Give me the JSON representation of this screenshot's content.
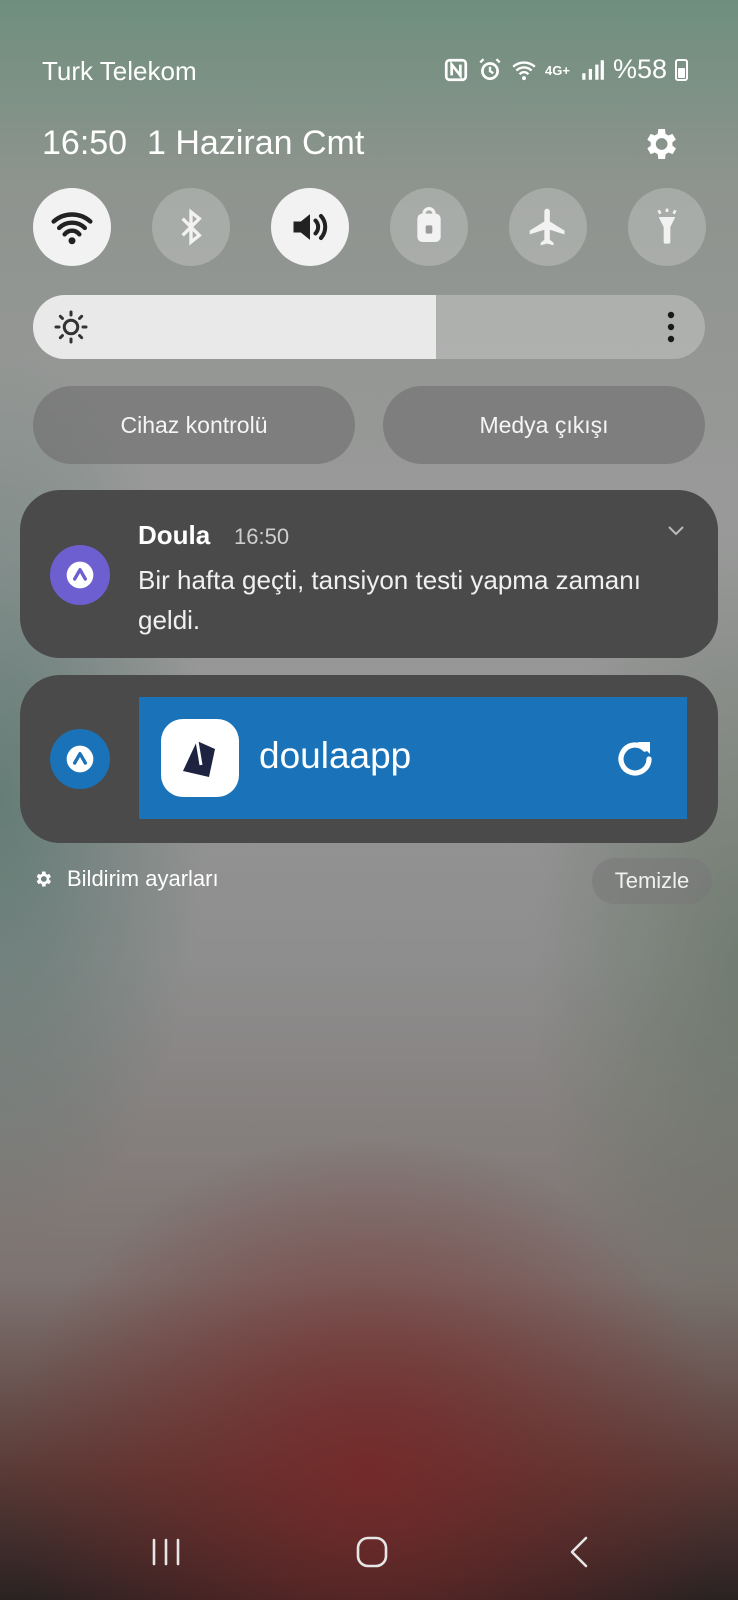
{
  "status_bar": {
    "carrier": "Turk Telekom",
    "battery_text": "%58",
    "icons": [
      "nfc-icon",
      "alarm-icon",
      "wifi-icon",
      "lte-plus-icon",
      "signal-icon",
      "battery-icon"
    ]
  },
  "panel": {
    "time": "16:50",
    "date": "1 Haziran Cmt",
    "quick_toggles": [
      {
        "name": "wifi",
        "on": true
      },
      {
        "name": "bluetooth",
        "on": false
      },
      {
        "name": "sound",
        "on": true
      },
      {
        "name": "screen-lock",
        "on": false
      },
      {
        "name": "airplane-mode",
        "on": false
      },
      {
        "name": "flashlight",
        "on": false
      }
    ],
    "brightness_level": 0.6,
    "device_control_label": "Cihaz kontrolü",
    "media_output_label": "Medya çıkışı"
  },
  "notifications": [
    {
      "app": "Doula",
      "time": "16:50",
      "body": "Bir hafta geçti, tansiyon testi yapma zamanı geldi.",
      "badge_color": "#6e5fd0"
    },
    {
      "title": "doulaapp",
      "badge_color": "#1a73b8",
      "widget_color": "#1a73b8"
    }
  ],
  "footer": {
    "notification_settings": "Bildirim ayarları",
    "clear": "Temizle"
  }
}
